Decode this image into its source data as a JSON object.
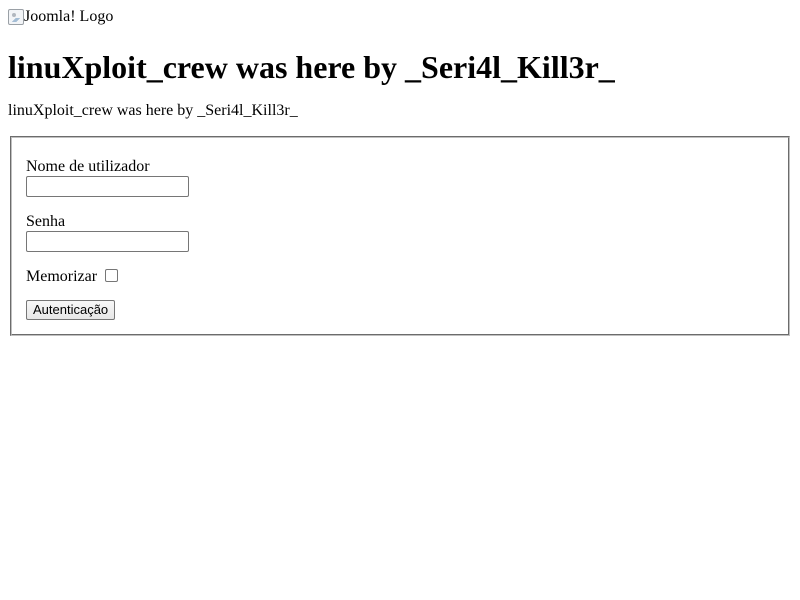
{
  "logo": {
    "alt_text": "Joomla! Logo",
    "icon": "broken-image-icon"
  },
  "page": {
    "heading": "linuXploit_crew was here by _Seri4l_Kill3r_",
    "subtitle": "linuXploit_crew was here by _Seri4l_Kill3r_"
  },
  "login_form": {
    "username_label": "Nome de utilizador",
    "username_value": "",
    "password_label": "Senha",
    "password_value": "",
    "remember_label": "Memorizar",
    "remember_checked": false,
    "submit_label": "Autenticação"
  }
}
